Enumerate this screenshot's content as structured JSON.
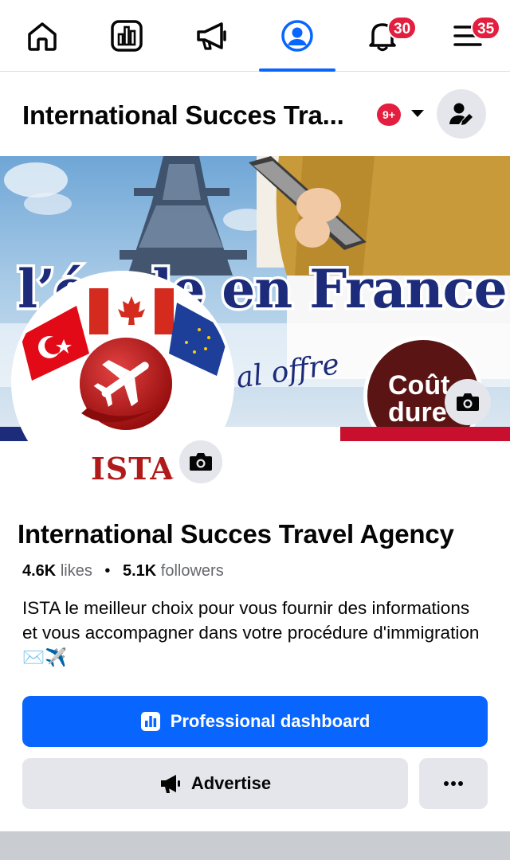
{
  "nav": {
    "tabs": [
      {
        "name": "home",
        "icon": "home-icon"
      },
      {
        "name": "dashboard",
        "icon": "dashboard-icon"
      },
      {
        "name": "ads",
        "icon": "megaphone-icon"
      },
      {
        "name": "profile",
        "icon": "profile-icon",
        "active": true
      },
      {
        "name": "notifications",
        "icon": "bell-icon",
        "badge": "30"
      },
      {
        "name": "menu",
        "icon": "menu-icon",
        "badge": "35"
      }
    ],
    "notifications_badge": "30",
    "menu_badge": "35",
    "active_color": "#0866ff"
  },
  "header": {
    "title": "International Succes Tra...",
    "badge": "9+"
  },
  "cover": {
    "headline": "l’école en France",
    "subline": "al offre",
    "seal_text": "Coût dure"
  },
  "avatar": {
    "brand": "ISTA"
  },
  "page": {
    "name": "International Succes Travel Agency",
    "likes_count": "4.6K",
    "likes_label": "likes",
    "followers_count": "5.1K",
    "followers_label": "followers",
    "separator": "•",
    "bio": "ISTA le meilleur choix pour vous fournir des informations et vous accompagner dans votre procédure d'immigration✉️✈️"
  },
  "actions": {
    "primary_label": "Professional dashboard",
    "secondary_label": "Advertise",
    "more_label": "•••"
  },
  "colors": {
    "primary": "#0866ff",
    "badge": "#e41e3f",
    "secondary_bg": "#e4e6eb"
  }
}
